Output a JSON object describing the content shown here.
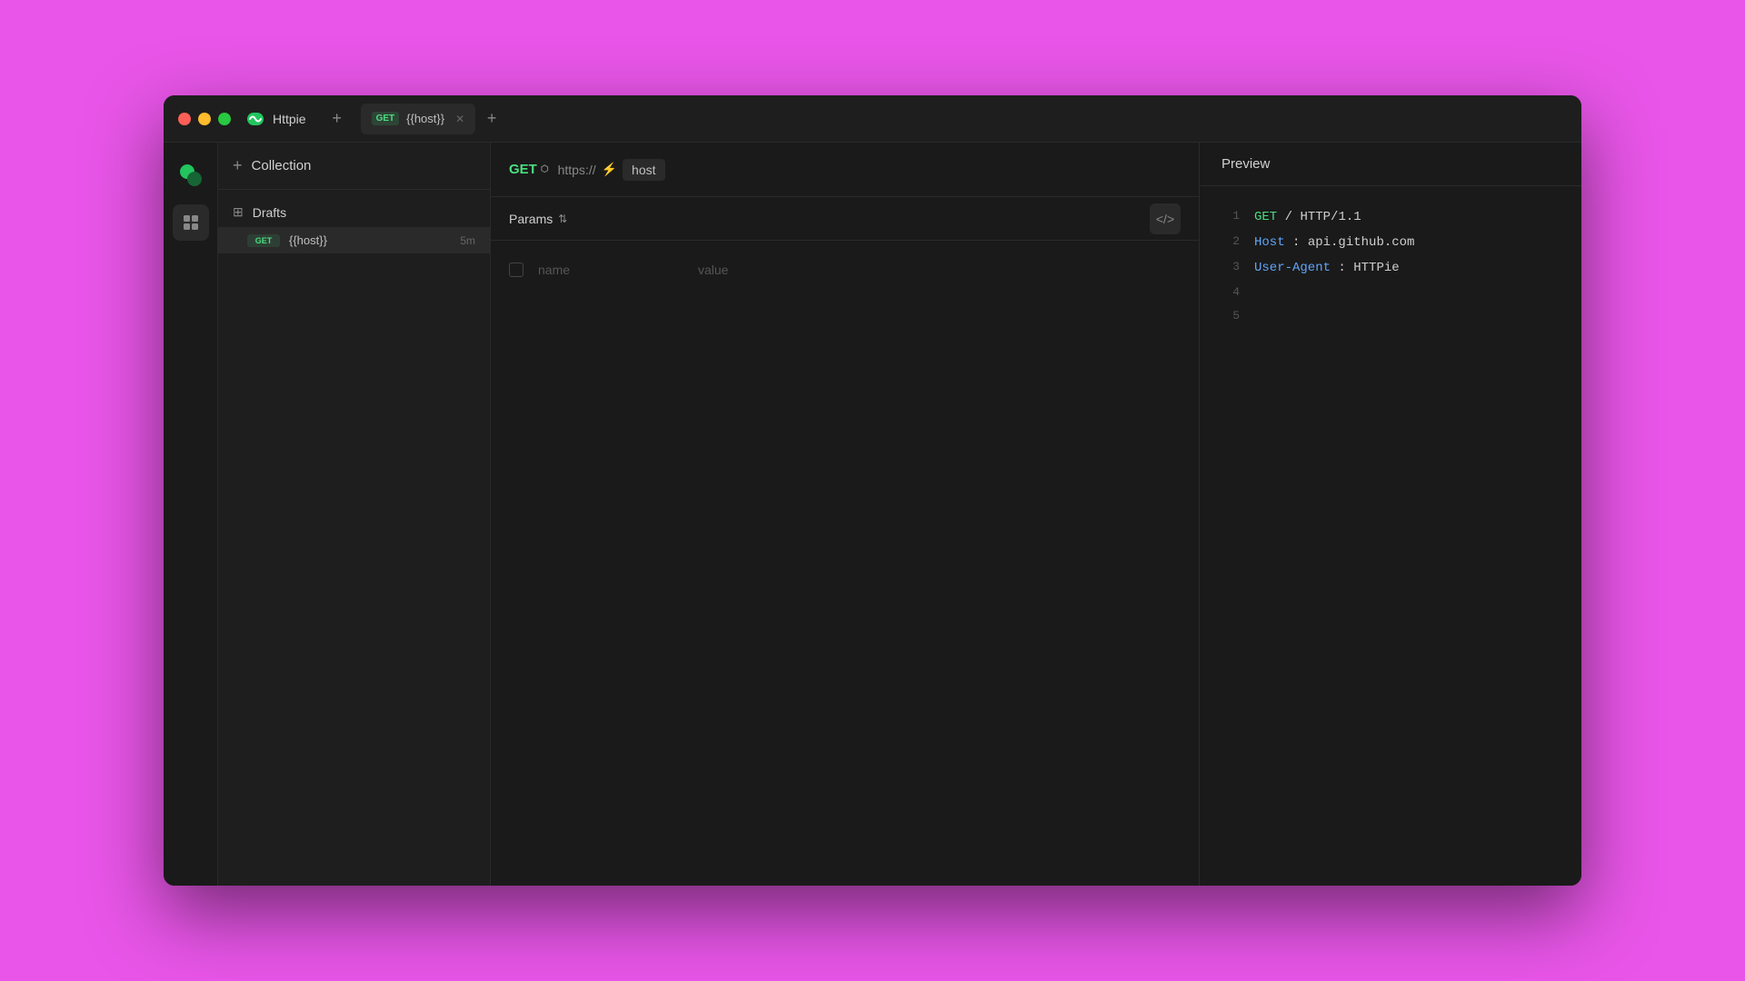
{
  "window": {
    "title": "Httpie",
    "controls": [
      "close",
      "minimize",
      "maximize"
    ]
  },
  "tabs": [
    {
      "method": "GET",
      "name": "{{host}}",
      "active": true
    }
  ],
  "sidebar": {
    "icons": [
      "logo",
      "grid"
    ]
  },
  "collection": {
    "add_label": "+",
    "title": "Collection",
    "folders": [
      {
        "name": "Drafts",
        "requests": [
          {
            "method": "GET",
            "name": "{{host}}",
            "time": "5m"
          }
        ]
      }
    ]
  },
  "url_bar": {
    "method": "GET",
    "prefix": "https://",
    "lightning": "⚡",
    "host": "host"
  },
  "params": {
    "label": "Params",
    "name_placeholder": "name",
    "value_placeholder": "value"
  },
  "preview": {
    "title": "Preview",
    "lines": [
      {
        "num": "1",
        "content": "GET / HTTP/1.1"
      },
      {
        "num": "2",
        "content": "Host: api.github.com"
      },
      {
        "num": "3",
        "content": "User-Agent: HTTPie"
      },
      {
        "num": "4",
        "content": ""
      },
      {
        "num": "5",
        "content": ""
      }
    ]
  },
  "colors": {
    "accent_green": "#4ade80",
    "accent_blue": "#60a5fa",
    "accent_yellow": "#eab308",
    "bg_dark": "#1a1a1a",
    "bg_medium": "#1e1e1e",
    "bg_light": "#2a2a2a",
    "text_primary": "#d0d0d0",
    "text_muted": "#888888",
    "text_dim": "#555555"
  }
}
